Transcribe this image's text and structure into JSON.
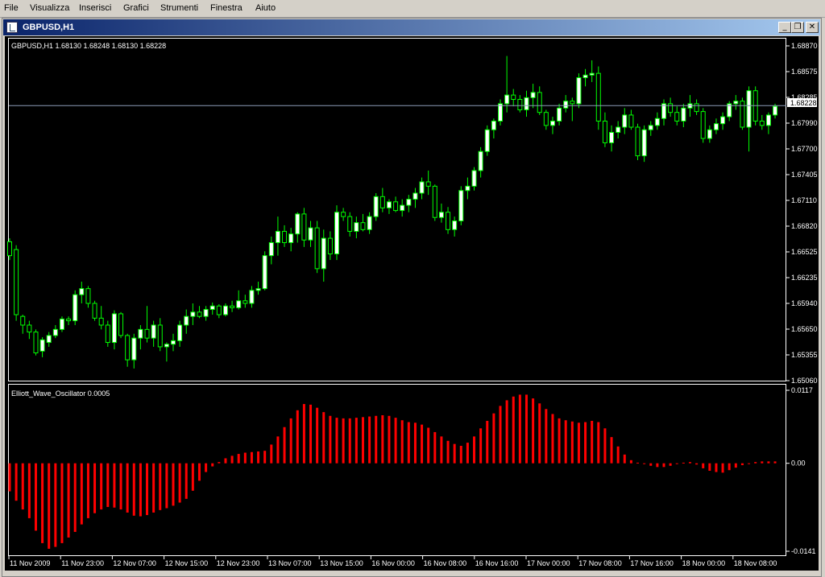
{
  "menu": [
    "File",
    "Visualizza",
    "Inserisci",
    "Grafici",
    "Strumenti",
    "Finestra",
    "Aiuto"
  ],
  "window": {
    "title": "GBPUSD,H1",
    "minimize_glyph": "_",
    "restore_glyph": "❐",
    "close_glyph": "✕"
  },
  "price_header": "GBPUSD,H1  1.68130 1.68248 1.68130 1.68228",
  "osc_header": "Elliott_Wave_Oscillator 0.0005",
  "price_labels": [
    "1.68870",
    "1.68575",
    "1.68285",
    "1.67990",
    "1.67700",
    "1.67405",
    "1.67110",
    "1.66820",
    "1.66525",
    "1.66235",
    "1.65940",
    "1.65650",
    "1.65355",
    "1.65060"
  ],
  "current_price": "1.68228",
  "osc_labels": [
    "0.0117",
    "0.00",
    "-0.0141"
  ],
  "time_labels": [
    "11 Nov 2009",
    "11 Nov 23:00",
    "12 Nov 07:00",
    "12 Nov 15:00",
    "12 Nov 23:00",
    "13 Nov 07:00",
    "13 Nov 15:00",
    "16 Nov 00:00",
    "16 Nov 08:00",
    "16 Nov 16:00",
    "17 Nov 00:00",
    "17 Nov 08:00",
    "17 Nov 16:00",
    "18 Nov 00:00",
    "18 Nov 08:00"
  ],
  "colors": {
    "background": "#000000",
    "grid": "#ffffff",
    "bull_body": "#ffffff",
    "bear_body": "#000000",
    "wick": "#00ff00",
    "osc_bar": "#ff0000",
    "current_line": "#8c9cb8"
  },
  "chart_data": [
    {
      "type": "candlestick",
      "title": "GBPUSD,H1",
      "ylim": [
        1.6506,
        1.69
      ],
      "current_price": 1.68228,
      "candles": [
        [
          1.6666,
          1.667,
          1.6645,
          1.665
        ],
        [
          1.6657,
          1.6662,
          1.6575,
          1.6582
        ],
        [
          1.658,
          1.6582,
          1.656,
          1.657
        ],
        [
          1.657,
          1.6575,
          1.6554,
          1.6562
        ],
        [
          1.6562,
          1.6565,
          1.6535,
          1.6538
        ],
        [
          1.654,
          1.6556,
          1.6533,
          1.6553
        ],
        [
          1.655,
          1.6562,
          1.6545,
          1.6558
        ],
        [
          1.6558,
          1.657,
          1.6555,
          1.6565
        ],
        [
          1.6565,
          1.658,
          1.6562,
          1.6577
        ],
        [
          1.6577,
          1.658,
          1.657,
          1.6575
        ],
        [
          1.6575,
          1.661,
          1.657,
          1.6605
        ],
        [
          1.6605,
          1.662,
          1.6595,
          1.6612
        ],
        [
          1.6612,
          1.6615,
          1.659,
          1.6595
        ],
        [
          1.6595,
          1.6598,
          1.6575,
          1.6578
        ],
        [
          1.6578,
          1.6592,
          1.6565,
          1.657
        ],
        [
          1.657,
          1.6575,
          1.6545,
          1.655
        ],
        [
          1.655,
          1.6587,
          1.6542,
          1.6583
        ],
        [
          1.6583,
          1.6585,
          1.6555,
          1.6558
        ],
        [
          1.6558,
          1.656,
          1.6522,
          1.653
        ],
        [
          1.653,
          1.656,
          1.652,
          1.6555
        ],
        [
          1.6555,
          1.657,
          1.6542,
          1.6565
        ],
        [
          1.6565,
          1.6592,
          1.655,
          1.6555
        ],
        [
          1.6555,
          1.6575,
          1.6545,
          1.657
        ],
        [
          1.657,
          1.6578,
          1.654,
          1.6545
        ],
        [
          1.6545,
          1.655,
          1.6528,
          1.6548
        ],
        [
          1.6548,
          1.656,
          1.654,
          1.6552
        ],
        [
          1.6552,
          1.6575,
          1.6545,
          1.657
        ],
        [
          1.657,
          1.6588,
          1.656,
          1.658
        ],
        [
          1.658,
          1.6595,
          1.657,
          1.6585
        ],
        [
          1.6585,
          1.6592,
          1.6578,
          1.658
        ],
        [
          1.658,
          1.6592,
          1.6575,
          1.6588
        ],
        [
          1.6588,
          1.6596,
          1.6582,
          1.6592
        ],
        [
          1.6592,
          1.6594,
          1.6578,
          1.6582
        ],
        [
          1.6582,
          1.6595,
          1.658,
          1.6592
        ],
        [
          1.6592,
          1.6598,
          1.6585,
          1.659
        ],
        [
          1.659,
          1.661,
          1.6588,
          1.6598
        ],
        [
          1.6598,
          1.6605,
          1.659,
          1.6595
        ],
        [
          1.6595,
          1.6615,
          1.659,
          1.661
        ],
        [
          1.661,
          1.662,
          1.6605,
          1.6612
        ],
        [
          1.6612,
          1.6655,
          1.661,
          1.665
        ],
        [
          1.665,
          1.6672,
          1.664,
          1.6665
        ],
        [
          1.6665,
          1.6695,
          1.665,
          1.6678
        ],
        [
          1.6678,
          1.6685,
          1.666,
          1.6665
        ],
        [
          1.6665,
          1.6682,
          1.6655,
          1.6675
        ],
        [
          1.6675,
          1.67,
          1.6665,
          1.6698
        ],
        [
          1.6698,
          1.6705,
          1.666,
          1.6668
        ],
        [
          1.6668,
          1.669,
          1.666,
          1.6682
        ],
        [
          1.6682,
          1.669,
          1.663,
          1.6635
        ],
        [
          1.6635,
          1.668,
          1.662,
          1.667
        ],
        [
          1.667,
          1.6678,
          1.6645,
          1.6652
        ],
        [
          1.6652,
          1.6708,
          1.6645,
          1.67
        ],
        [
          1.67,
          1.6705,
          1.669,
          1.6695
        ],
        [
          1.6695,
          1.67,
          1.6672,
          1.6678
        ],
        [
          1.6678,
          1.6695,
          1.667,
          1.6688
        ],
        [
          1.6688,
          1.6698,
          1.6678,
          1.668
        ],
        [
          1.668,
          1.67,
          1.6675,
          1.6695
        ],
        [
          1.6695,
          1.6722,
          1.669,
          1.6718
        ],
        [
          1.6718,
          1.6728,
          1.67,
          1.6705
        ],
        [
          1.6705,
          1.6715,
          1.6698,
          1.6712
        ],
        [
          1.6712,
          1.6718,
          1.67,
          1.6702
        ],
        [
          1.6702,
          1.6715,
          1.6695,
          1.6708
        ],
        [
          1.6708,
          1.672,
          1.67,
          1.6715
        ],
        [
          1.6715,
          1.6728,
          1.6705,
          1.6722
        ],
        [
          1.6722,
          1.674,
          1.6715,
          1.6735
        ],
        [
          1.6735,
          1.6748,
          1.672,
          1.673
        ],
        [
          1.673,
          1.6732,
          1.669,
          1.6694
        ],
        [
          1.6694,
          1.671,
          1.6688,
          1.67
        ],
        [
          1.67,
          1.6706,
          1.6675,
          1.668
        ],
        [
          1.668,
          1.6695,
          1.6672,
          1.669
        ],
        [
          1.669,
          1.673,
          1.6685,
          1.6725
        ],
        [
          1.6725,
          1.674,
          1.6715,
          1.673
        ],
        [
          1.673,
          1.6752,
          1.6725,
          1.6748
        ],
        [
          1.6748,
          1.6775,
          1.674,
          1.677
        ],
        [
          1.677,
          1.68,
          1.6765,
          1.6795
        ],
        [
          1.6795,
          1.6808,
          1.6785,
          1.6805
        ],
        [
          1.6805,
          1.683,
          1.68,
          1.6825
        ],
        [
          1.6825,
          1.688,
          1.6815,
          1.6835
        ],
        [
          1.6835,
          1.6842,
          1.6822,
          1.683
        ],
        [
          1.683,
          1.6835,
          1.6815,
          1.6818
        ],
        [
          1.6818,
          1.684,
          1.681,
          1.6832
        ],
        [
          1.6832,
          1.6848,
          1.682,
          1.6838
        ],
        [
          1.6838,
          1.6845,
          1.6812,
          1.6815
        ],
        [
          1.6815,
          1.6818,
          1.6795,
          1.68
        ],
        [
          1.68,
          1.681,
          1.679,
          1.6805
        ],
        [
          1.6805,
          1.6825,
          1.68,
          1.682
        ],
        [
          1.682,
          1.6835,
          1.6815,
          1.6828
        ],
        [
          1.6828,
          1.6832,
          1.6805,
          1.6825
        ],
        [
          1.6825,
          1.686,
          1.682,
          1.6855
        ],
        [
          1.6855,
          1.6865,
          1.6845,
          1.6858
        ],
        [
          1.6858,
          1.6875,
          1.685,
          1.686
        ],
        [
          1.686,
          1.6868,
          1.6795,
          1.6805
        ],
        [
          1.6805,
          1.6815,
          1.6775,
          1.678
        ],
        [
          1.678,
          1.68,
          1.677,
          1.6792
        ],
        [
          1.6792,
          1.6805,
          1.6785,
          1.6798
        ],
        [
          1.6798,
          1.682,
          1.679,
          1.6812
        ],
        [
          1.6812,
          1.6818,
          1.6795,
          1.6798
        ],
        [
          1.6798,
          1.6802,
          1.676,
          1.6765
        ],
        [
          1.6765,
          1.68,
          1.6758,
          1.6795
        ],
        [
          1.6795,
          1.6805,
          1.6788,
          1.68
        ],
        [
          1.68,
          1.6815,
          1.6795,
          1.6808
        ],
        [
          1.6808,
          1.683,
          1.68,
          1.6825
        ],
        [
          1.6825,
          1.6832,
          1.681,
          1.6815
        ],
        [
          1.6815,
          1.6822,
          1.68,
          1.6805
        ],
        [
          1.6805,
          1.6825,
          1.6798,
          1.682
        ],
        [
          1.682,
          1.6835,
          1.681,
          1.6825
        ],
        [
          1.6825,
          1.683,
          1.6812,
          1.6816
        ],
        [
          1.6816,
          1.682,
          1.678,
          1.6785
        ],
        [
          1.6785,
          1.68,
          1.678,
          1.6795
        ],
        [
          1.6795,
          1.6808,
          1.679,
          1.6802
        ],
        [
          1.6802,
          1.6815,
          1.6795,
          1.681
        ],
        [
          1.681,
          1.6828,
          1.6805,
          1.6825
        ],
        [
          1.6825,
          1.6835,
          1.6818,
          1.6828
        ],
        [
          1.6828,
          1.6832,
          1.6795,
          1.6798
        ],
        [
          1.6798,
          1.6845,
          1.677,
          1.684
        ],
        [
          1.684,
          1.6845,
          1.68,
          1.6805
        ],
        [
          1.6805,
          1.6812,
          1.6795,
          1.68
        ],
        [
          1.68,
          1.6815,
          1.679,
          1.6812
        ],
        [
          1.6812,
          1.6825,
          1.6808,
          1.6822
        ]
      ]
    },
    {
      "type": "bar",
      "title": "Elliott_Wave_Oscillator 0.0005",
      "ylim": [
        -0.0141,
        0.0117
      ],
      "values": [
        -0.0045,
        -0.006,
        -0.0074,
        -0.0088,
        -0.0108,
        -0.0128,
        -0.0137,
        -0.0134,
        -0.0128,
        -0.0119,
        -0.011,
        -0.0098,
        -0.0088,
        -0.008,
        -0.0074,
        -0.007,
        -0.0071,
        -0.0074,
        -0.0079,
        -0.0084,
        -0.0085,
        -0.0083,
        -0.0079,
        -0.0075,
        -0.0072,
        -0.0068,
        -0.0063,
        -0.0057,
        -0.0044,
        -0.0028,
        -0.0014,
        -0.0005,
        0.0002,
        0.0008,
        0.0012,
        0.0015,
        0.0017,
        0.0018,
        0.0019,
        0.002,
        0.003,
        0.0043,
        0.0058,
        0.0072,
        0.0085,
        0.0095,
        0.0094,
        0.0089,
        0.0082,
        0.0076,
        0.0073,
        0.0072,
        0.0072,
        0.0073,
        0.0074,
        0.0075,
        0.0076,
        0.0077,
        0.0076,
        0.0073,
        0.0069,
        0.0066,
        0.0065,
        0.0062,
        0.0057,
        0.005,
        0.0043,
        0.0036,
        0.0031,
        0.0028,
        0.0033,
        0.0043,
        0.0056,
        0.0068,
        0.008,
        0.0092,
        0.0101,
        0.0107,
        0.011,
        0.011,
        0.0104,
        0.0096,
        0.0087,
        0.0079,
        0.0072,
        0.0069,
        0.0067,
        0.0065,
        0.0066,
        0.0068,
        0.0066,
        0.0056,
        0.0042,
        0.0027,
        0.0014,
        0.0005,
        0.0001,
        -0.0001,
        -0.0004,
        -0.0006,
        -0.0006,
        -0.0004,
        -0.0001,
        0.0001,
        0.0002,
        -0.0002,
        -0.0008,
        -0.0012,
        -0.0014,
        -0.0015,
        -0.0011,
        -0.0007,
        -0.0003,
        -0.0001,
        0.0002,
        0.0003,
        0.0003,
        0.0003
      ]
    }
  ]
}
